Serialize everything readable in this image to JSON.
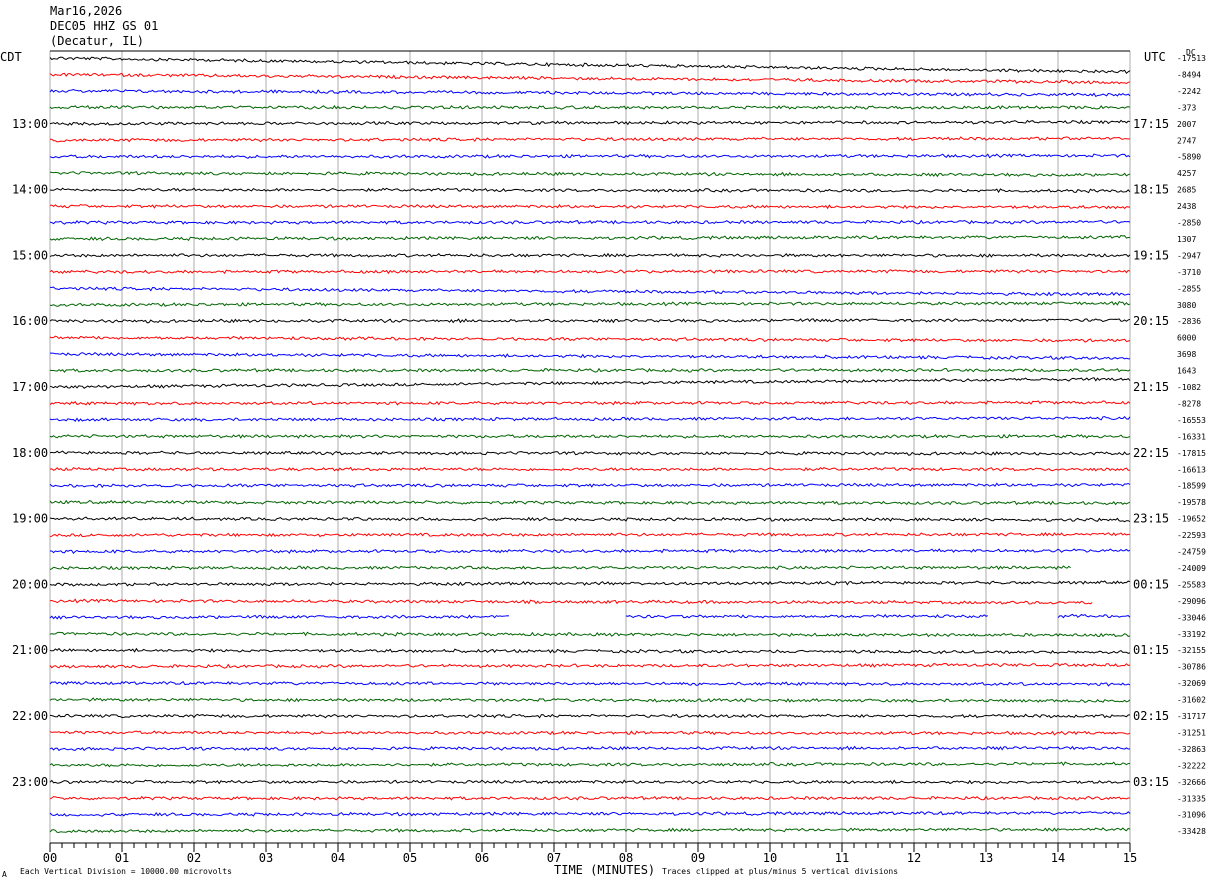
{
  "header": {
    "date": "Mar16,2026",
    "station": "DEC05 HHZ GS 01",
    "location": "(Decatur, IL)"
  },
  "left_tz": "CDT",
  "right_tz": "UTC",
  "corner_note": "DC",
  "footer": {
    "left_mark": "A",
    "scale_note": "Each Vertical Division = 10000.00 microvolts",
    "xlabel": "TIME (MINUTES)",
    "clip_note": "Traces clipped at plus/minus 5 vertical divisions"
  },
  "chart_data": {
    "type": "line",
    "title": "DEC05 HHZ GS 01",
    "xlabel": "TIME (MINUTES)",
    "xlim": [
      0,
      15
    ],
    "x_ticks": [
      "00",
      "01",
      "02",
      "03",
      "04",
      "05",
      "06",
      "07",
      "08",
      "09",
      "10",
      "11",
      "12",
      "13",
      "14",
      "15"
    ],
    "trace_colors": [
      "#000000",
      "#ff0000",
      "#0000ff",
      "#006400"
    ],
    "left_hour_labels": [
      "13:00",
      "14:00",
      "15:00",
      "16:00",
      "17:00",
      "18:00",
      "19:00",
      "20:00",
      "21:00",
      "22:00",
      "23:00"
    ],
    "right_hour_labels": [
      "17:15",
      "18:15",
      "19:15",
      "20:15",
      "21:15",
      "22:15",
      "23:15",
      "00:15",
      "01:15",
      "02:15",
      "03:15"
    ],
    "trace_offsets": [
      "-17513",
      "-8494",
      "-2242",
      "-373",
      "2007",
      "2747",
      "-5890",
      "4257",
      "2685",
      "2438",
      "-2850",
      "1307",
      "-2947",
      "-3710",
      "-2855",
      "3080",
      "-2836",
      "6000",
      "3698",
      "1643",
      "-1082",
      "-8278",
      "-16553",
      "-16331",
      "-17815",
      "-16613",
      "-18599",
      "-19578",
      "-19652",
      "-22593",
      "-24759",
      "-24009",
      "-25583",
      "-29096",
      "-33046",
      "-33192",
      "-32155",
      "-30786",
      "-32069",
      "-31602",
      "-31717",
      "-31251",
      "-32863",
      "-32222",
      "-32666",
      "-31335",
      "-31096",
      "-33428"
    ],
    "gaps": [
      {
        "trace": 31,
        "from_min": 14.2,
        "to_min": 15
      },
      {
        "trace": 33,
        "from_min": 14.5,
        "to_min": 15
      },
      {
        "trace": 34,
        "from_min": 6.4,
        "to_min": 8.0
      },
      {
        "trace": 34,
        "from_min": 13.05,
        "to_min": 14.0
      }
    ],
    "notes": "48 traces of 15 minutes each, hourly labels every 4 traces"
  }
}
